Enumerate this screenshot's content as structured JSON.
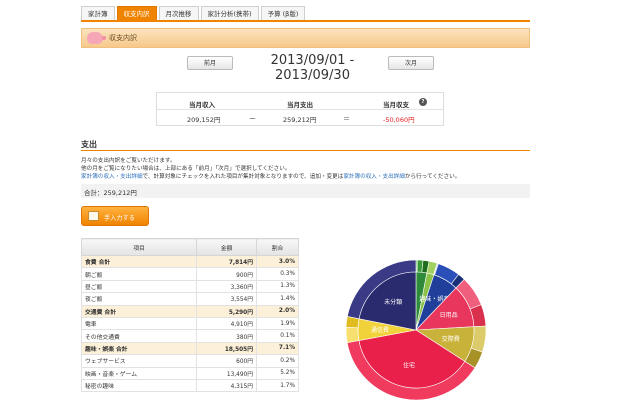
{
  "tabs": [
    {
      "label": "家計簿",
      "active": false
    },
    {
      "label": "収支内訳",
      "active": true
    },
    {
      "label": "月次推移",
      "active": false
    },
    {
      "label": "家計分析(携帯)",
      "active": false
    },
    {
      "label": "予算 (β版)",
      "active": false
    }
  ],
  "section_bar": {
    "title": "収支内訳"
  },
  "period": {
    "prev_label": "前月",
    "range": "2013/09/01 - 2013/09/30",
    "next_label": "次月"
  },
  "summary": {
    "income_label": "当月収入",
    "expense_label": "当月支出",
    "balance_label": "当月収支",
    "income": "209,152円",
    "expense": "259,212円",
    "balance": "-50,060円",
    "minus_sign": "ー",
    "equal_sign": "＝",
    "help": "?"
  },
  "expense_section": {
    "title": "支出",
    "desc1": "月々の支出内訳をご覧いただけます。",
    "desc2": "他の月をご覧になりたい場合は、上部にある「前月」「次月」で選択してください。",
    "desc3_link1": "家計簿の収入・支出詳細",
    "desc3_mid": "で、計算対象にチェックを入れた項目が集計対象となりますので、追加・変更は",
    "desc3_link2": "家計簿の収入・支出詳細",
    "desc3_end": "から行ってください。",
    "total": "合計：259,212円",
    "entry_button": "手入力する"
  },
  "table": {
    "headers": [
      "項目",
      "金額",
      "割合"
    ],
    "rows": [
      {
        "name": "食費 合計",
        "amount": "7,814円",
        "pct": "3.0%",
        "group": true
      },
      {
        "name": "朝ご飯",
        "amount": "900円",
        "pct": "0.3%",
        "group": false
      },
      {
        "name": "昼ご飯",
        "amount": "3,360円",
        "pct": "1.3%",
        "group": false
      },
      {
        "name": "夜ご飯",
        "amount": "3,554円",
        "pct": "1.4%",
        "group": false
      },
      {
        "name": "交通費 合計",
        "amount": "5,290円",
        "pct": "2.0%",
        "group": true
      },
      {
        "name": "電車",
        "amount": "4,910円",
        "pct": "1.9%",
        "group": false
      },
      {
        "name": "その他交通費",
        "amount": "380円",
        "pct": "0.1%",
        "group": false
      },
      {
        "name": "趣味・娯楽 合計",
        "amount": "18,505円",
        "pct": "7.1%",
        "group": true
      },
      {
        "name": "ウェブサービス",
        "amount": "600円",
        "pct": "0.2%",
        "group": false
      },
      {
        "name": "映画・音楽・ゲーム",
        "amount": "13,490円",
        "pct": "5.2%",
        "group": false
      },
      {
        "name": "秘密の趣味",
        "amount": "4,315円",
        "pct": "1.7%",
        "group": false
      }
    ]
  },
  "chart_data": {
    "type": "pie",
    "inner": [
      {
        "label": "",
        "value": 3.0,
        "color": "#2e8b3a"
      },
      {
        "label": "",
        "value": 2.0,
        "color": "#8bc34a"
      },
      {
        "label": "趣味・娯楽",
        "value": 7.1,
        "color": "#1f3f9a"
      },
      {
        "label": "日用品",
        "value": 12.0,
        "color": "#e8365d"
      },
      {
        "label": "交際費",
        "value": 10.0,
        "color": "#c9b23a"
      },
      {
        "label": "住宅",
        "value": 38.0,
        "color": "#e8204a"
      },
      {
        "label": "通信費",
        "value": 6.0,
        "color": "#f2d23a"
      },
      {
        "label": "未分類",
        "value": 21.9,
        "color": "#2a2a6e"
      }
    ],
    "outer": [
      {
        "value": 0.3,
        "color": "#5cb85c"
      },
      {
        "value": 1.3,
        "color": "#3a9a3a"
      },
      {
        "value": 1.4,
        "color": "#1e6e1e"
      },
      {
        "value": 1.9,
        "color": "#a0d060"
      },
      {
        "value": 0.1,
        "color": "#c8e6a0"
      },
      {
        "value": 0.2,
        "color": "#6a8ae0"
      },
      {
        "value": 5.2,
        "color": "#2a4fb8"
      },
      {
        "value": 1.7,
        "color": "#16307a"
      },
      {
        "value": 7.0,
        "color": "#f0607e"
      },
      {
        "value": 5.0,
        "color": "#d9304e"
      },
      {
        "value": 6.0,
        "color": "#dccb6a"
      },
      {
        "value": 4.0,
        "color": "#a89228"
      },
      {
        "value": 38.0,
        "color": "#f03a5e"
      },
      {
        "value": 3.5,
        "color": "#f7e070"
      },
      {
        "value": 2.5,
        "color": "#e0bc20"
      },
      {
        "value": 21.9,
        "color": "#3a3a86"
      }
    ]
  }
}
